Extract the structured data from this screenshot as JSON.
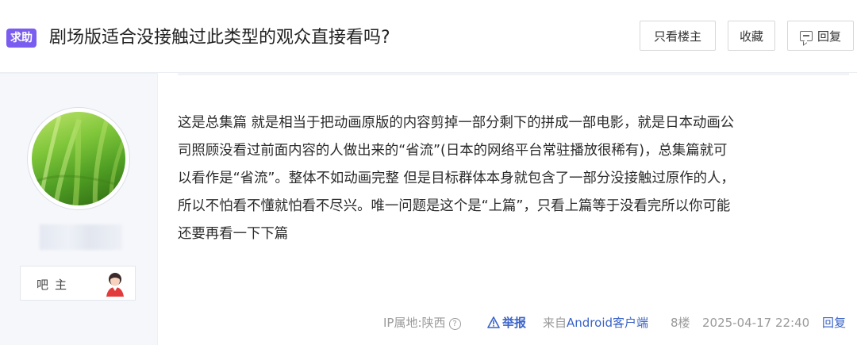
{
  "header": {
    "tag": "求助",
    "title": "剧场版适合没接触过此类型的观众直接看吗?",
    "buttons": {
      "only_op": "只看楼主",
      "collect": "收藏",
      "reply": "回复"
    }
  },
  "user": {
    "rank_label": "吧主"
  },
  "post": {
    "lines": [
      "这是总集篇 就是相当于把动画原版的内容剪掉一部分剩下的拼成一部电影，就是日本动画公",
      "司照顾没看过前面内容的人做出来的“省流”(日本的网络平台常驻播放很稀有)，总集篇就可",
      "以看作是“省流”。整体不如动画完整 但是目标群体本身就包含了一部分没接触过原作的人，",
      "所以不怕看不懂就怕看不尽兴。唯一问题是这个是“上篇”，只看上篇等于没看完所以你可能",
      "还要再看一下下篇"
    ]
  },
  "meta": {
    "ip": "IP属地:陕西",
    "help_glyph": "?",
    "report": "举报",
    "source_prefix": "来自",
    "source_client": "Android客户端",
    "floor": "8楼",
    "time": "2025-04-17 22:40",
    "reply": "回复"
  },
  "icons": {
    "reply": "comment-icon",
    "report": "warning-icon",
    "help": "question-circle-icon",
    "rank": "admin-avatar-icon"
  },
  "colors": {
    "tag_bg": "#7a5cf0",
    "link": "#3a63c7",
    "muted": "#9a9a9a",
    "panel_bg": "#f5f7fb"
  }
}
